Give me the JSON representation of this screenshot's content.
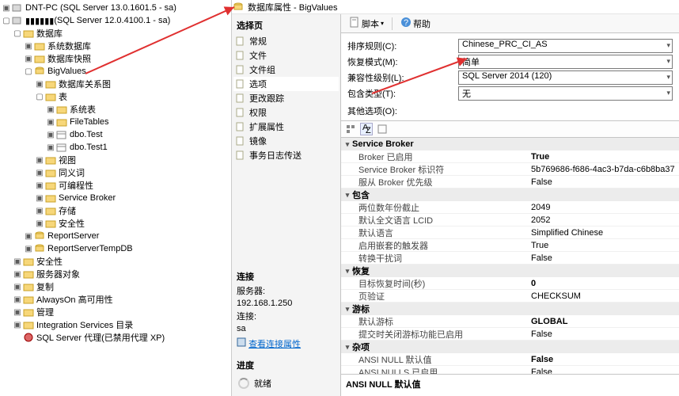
{
  "tree": {
    "root1": "DNT-PC (SQL Server 13.0.1601.5 - sa)",
    "root2_suffix": " (SQL Server 12.0.4100.1 - sa)",
    "db_folder": "数据库",
    "sys_db": "系统数据库",
    "db_snap": "数据库快照",
    "bigvalues": "BigValues",
    "db_diag": "数据库关系图",
    "tables": "表",
    "sys_tables": "系统表",
    "file_tables": "FileTables",
    "dbo_test": "dbo.Test",
    "dbo_test1": "dbo.Test1",
    "views": "视图",
    "synonyms": "同义词",
    "programmability": "可编程性",
    "service_broker": "Service Broker",
    "storage": "存储",
    "security": "安全性",
    "report_server": "ReportServer",
    "report_server_temp": "ReportServerTempDB",
    "sec": "安全性",
    "server_obj": "服务器对象",
    "replication": "复制",
    "alwayson": "AlwaysOn 高可用性",
    "management": "管理",
    "integration": "Integration Services 目录",
    "sql_agent": "SQL Server 代理(已禁用代理 XP)"
  },
  "dialog": {
    "title": "数据库属性 - BigValues",
    "select_page": "选择页",
    "select_items": [
      "常规",
      "文件",
      "文件组",
      "选项",
      "更改跟踪",
      "权限",
      "扩展属性",
      "镜像",
      "事务日志传送"
    ],
    "conn_label": "连接",
    "server_label": "服务器:",
    "server_val": "192.168.1.250",
    "conn_user_label": "连接:",
    "conn_user_val": "sa",
    "view_conn_props": "查看连接属性",
    "progress_label": "进度",
    "progress_status": "就绪"
  },
  "toolbar": {
    "script": "脚本",
    "help": "帮助"
  },
  "form": {
    "collation_label": "排序规则(C):",
    "collation_val": "Chinese_PRC_CI_AS",
    "recovery_label": "恢复模式(M):",
    "recovery_val": "简单",
    "compat_label": "兼容性级别(L):",
    "compat_val": "SQL Server 2014 (120)",
    "containment_label": "包含类型(T):",
    "containment_val": "无",
    "other_label": "其他选项(O):"
  },
  "grid": {
    "cats": {
      "service_broker": "Service Broker",
      "containment": "包含",
      "recovery": "恢复",
      "cursor": "游标",
      "misc": "杂项"
    },
    "rows": [
      {
        "k": "Broker 已启用",
        "v": "True",
        "b": true
      },
      {
        "k": "Service Broker 标识符",
        "v": "5b769686-f686-4ac3-b7da-c6b8ba37"
      },
      {
        "k": "服从 Broker 优先级",
        "v": "False"
      }
    ],
    "containment_rows": [
      {
        "k": "两位数年份截止",
        "v": "2049"
      },
      {
        "k": "默认全文语言 LCID",
        "v": "2052"
      },
      {
        "k": "默认语言",
        "v": "Simplified Chinese"
      },
      {
        "k": "启用嵌套的触发器",
        "v": "True"
      },
      {
        "k": "转换干扰词",
        "v": "False"
      }
    ],
    "recovery_rows": [
      {
        "k": "目标恢复时间(秒)",
        "v": "0",
        "b": true
      },
      {
        "k": "页验证",
        "v": "CHECKSUM"
      }
    ],
    "cursor_rows": [
      {
        "k": "默认游标",
        "v": "GLOBAL",
        "b": true
      },
      {
        "k": "提交时关闭游标功能已启用",
        "v": "False"
      }
    ],
    "misc_rows": [
      {
        "k": "ANSI NULL 默认值",
        "v": "False",
        "b": true
      },
      {
        "k": "ANSI NULLS 已启用",
        "v": "False"
      }
    ],
    "help_text": "ANSI NULL 默认值"
  }
}
